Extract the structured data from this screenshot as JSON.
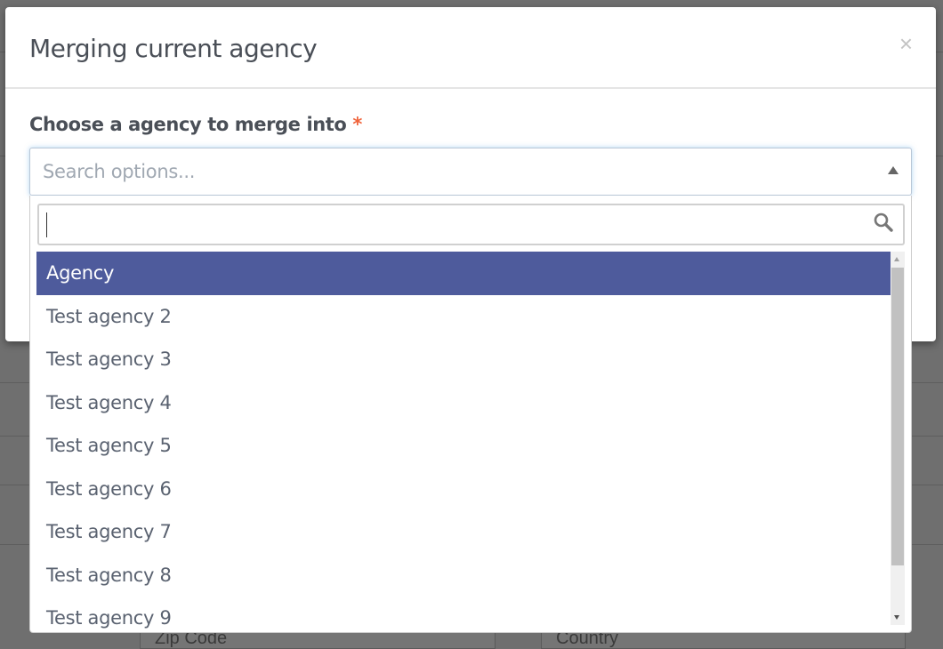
{
  "background": {
    "fields": [
      "Zip Code",
      "Country"
    ]
  },
  "modal": {
    "title": "Merging current agency",
    "close_label": "×",
    "field_label": "Choose a agency to merge into",
    "required_mark": "*",
    "select": {
      "placeholder": "Search options...",
      "search_value": "",
      "options": [
        {
          "label": "Agency",
          "highlighted": true
        },
        {
          "label": "Test agency 2"
        },
        {
          "label": "Test agency 3"
        },
        {
          "label": "Test agency 4"
        },
        {
          "label": "Test agency 5"
        },
        {
          "label": "Test agency 6"
        },
        {
          "label": "Test agency 7"
        },
        {
          "label": "Test agency 8"
        },
        {
          "label": "Test agency 9"
        }
      ]
    }
  },
  "colors": {
    "highlight": "#4e5b9c",
    "required": "#f0643c",
    "text": "#5a6270"
  }
}
